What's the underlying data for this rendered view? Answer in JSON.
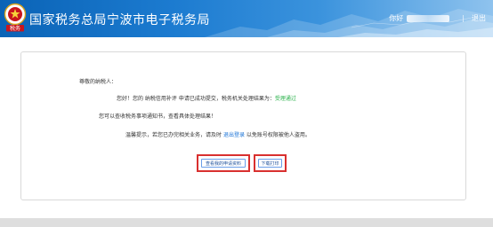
{
  "header": {
    "title": "国家税务总局宁波市电子税务局",
    "user_prefix": "你好",
    "exit_label": "退出",
    "separator": "|",
    "emblem_text": "税务"
  },
  "notice": {
    "greeting": "尊敬的纳税人：",
    "line1_prefix": "您好！您的 纳税信用补评 申请已成功提交，税务机关处理结果为：",
    "line1_status": "受理通过",
    "line2": "您可以查收税务事项通知书，查看具体处理结果！",
    "line3_prefix": "温馨提示，若您已办完相关业务，请及时",
    "line3_link": "退出登录",
    "line3_suffix": "以免账号权限被他人盗用。"
  },
  "buttons": {
    "view_materials": "查看我的申请资料",
    "download_print": "下载打印"
  },
  "colors": {
    "header_blue": "#0a63b6",
    "status_green": "#2bb24c",
    "link_blue": "#1a73d6",
    "highlight_red": "#d9302f"
  }
}
